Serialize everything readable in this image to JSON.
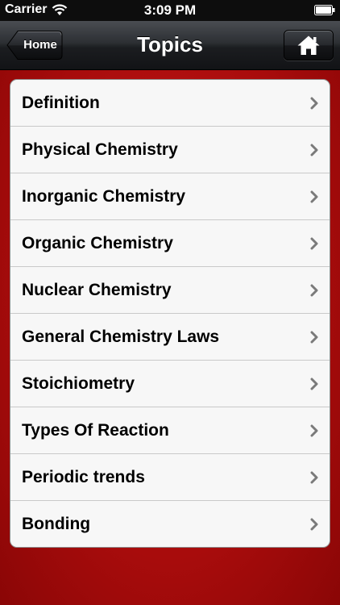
{
  "status_bar": {
    "carrier": "Carrier",
    "time": "3:09 PM",
    "wifi_icon": "wifi-icon",
    "battery_icon": "battery-icon"
  },
  "nav": {
    "title": "Topics",
    "back_label": "Home",
    "home_icon": "home-icon"
  },
  "colors": {
    "background_red": "#b01010",
    "nav_dark": "#2c2f33",
    "list_bg": "#f7f7f7",
    "chevron": "#7a7a7a"
  },
  "topics": [
    {
      "label": "Definition"
    },
    {
      "label": "Physical Chemistry"
    },
    {
      "label": "Inorganic Chemistry"
    },
    {
      "label": "Organic Chemistry"
    },
    {
      "label": "Nuclear Chemistry"
    },
    {
      "label": "General Chemistry Laws"
    },
    {
      "label": "Stoichiometry"
    },
    {
      "label": "Types Of Reaction"
    },
    {
      "label": "Periodic trends"
    },
    {
      "label": "Bonding"
    }
  ]
}
